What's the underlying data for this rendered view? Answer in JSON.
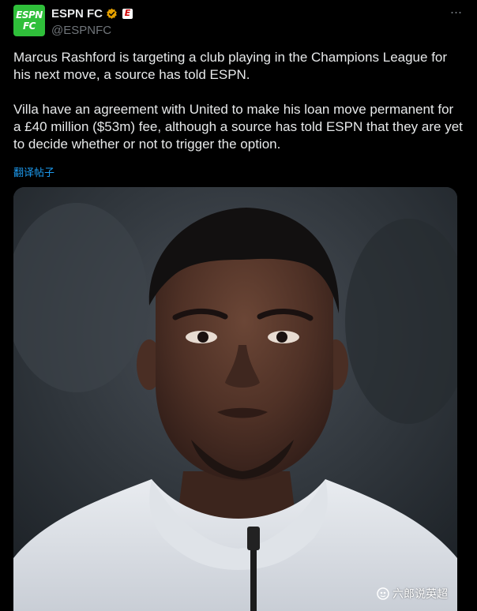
{
  "account": {
    "avatar_line1": "ESPN",
    "avatar_line2": "FC",
    "display_name": "ESPN FC",
    "handle": "@ESPNFC",
    "affiliate_badge": "E",
    "verified_icon": "gold-verified-badge-icon",
    "brand_color": "#2fbf3a"
  },
  "tweet": {
    "paragraph1": "Marcus Rashford is targeting a club playing in the Champions League for his next move, a source has told ESPN.",
    "paragraph2": "Villa have an agreement with United to make his loan move permanent for a £40 million ($53m) fee, although a source has told ESPN that they are yet to decide whether or not to trigger the option.",
    "translate_link": "翻译帖子",
    "more_icon": "more-options-icon"
  },
  "media": {
    "watermark": "六郎说英超",
    "watermark_icon": "platform-logo-icon"
  },
  "colors": {
    "background": "#000000",
    "text": "#e7e9ea",
    "muted": "#71767b",
    "link": "#1d9bf0",
    "verified": "#e6a100"
  }
}
